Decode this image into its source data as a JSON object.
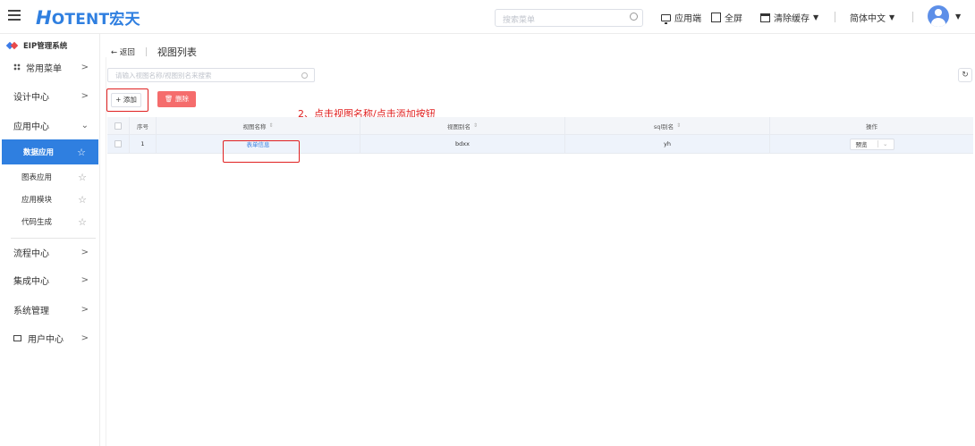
{
  "header": {
    "logo_mark": "H",
    "logo_text": "OTENT宏天",
    "search_placeholder": "搜索菜单",
    "app_end": "应用端",
    "fullscreen": "全屏",
    "clear_cache": "清除缓存",
    "language": "简体中文"
  },
  "sidebar": {
    "system_title": "EIP管理系统",
    "items": [
      {
        "label": "常用菜单"
      },
      {
        "label": "设计中心"
      },
      {
        "label": "应用中心"
      },
      {
        "label": "流程中心"
      },
      {
        "label": "集成中心"
      },
      {
        "label": "系统管理"
      },
      {
        "label": "用户中心"
      }
    ],
    "sub_items": [
      {
        "label": "数据应用"
      },
      {
        "label": "图表应用"
      },
      {
        "label": "应用模块"
      },
      {
        "label": "代码生成"
      }
    ]
  },
  "page": {
    "back": "← 返回",
    "title": "视图列表",
    "filter_placeholder": "请输入视图名称/视图别名来搜索",
    "add_button": "+ 添加",
    "delete_button": "🗑 删除",
    "annotation": "2、点击视图名称/点击添加按钮"
  },
  "table": {
    "headers": [
      "序号",
      "视图名称",
      "视图别名",
      "sql别名",
      "操作"
    ],
    "rows": [
      {
        "index": "1",
        "name": "表单信息",
        "alias": "bdxx",
        "sql_alias": "yh",
        "action": "预览"
      }
    ]
  },
  "colors": {
    "accent": "#2f7fe0",
    "danger": "#f56c6c",
    "annotation": "#e02020"
  }
}
